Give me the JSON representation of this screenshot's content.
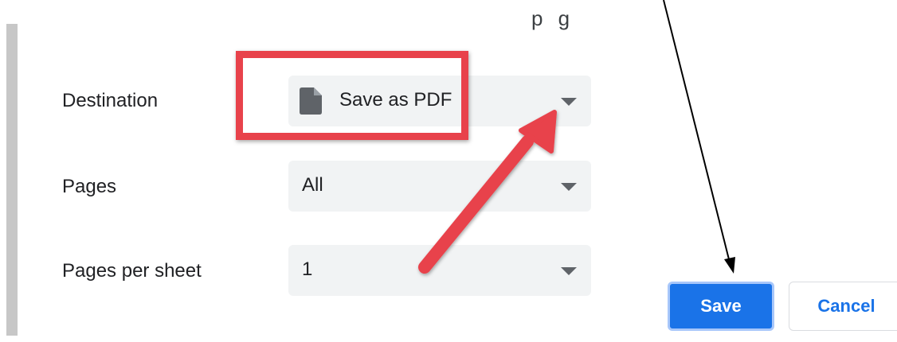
{
  "header": {
    "fragment": "p g"
  },
  "form": {
    "destination": {
      "label": "Destination",
      "value": "Save as PDF",
      "icon": "document-icon"
    },
    "pages": {
      "label": "Pages",
      "value": "All"
    },
    "pages_per_sheet": {
      "label": "Pages per sheet",
      "value": "1"
    }
  },
  "buttons": {
    "save": "Save",
    "cancel": "Cancel"
  },
  "annotations": {
    "highlight_color": "#e8424b",
    "arrow_color": "#e8424b",
    "pointer_arrow_color": "#000000"
  },
  "colors": {
    "accent": "#1a73e8",
    "field_background": "#f1f3f4"
  }
}
